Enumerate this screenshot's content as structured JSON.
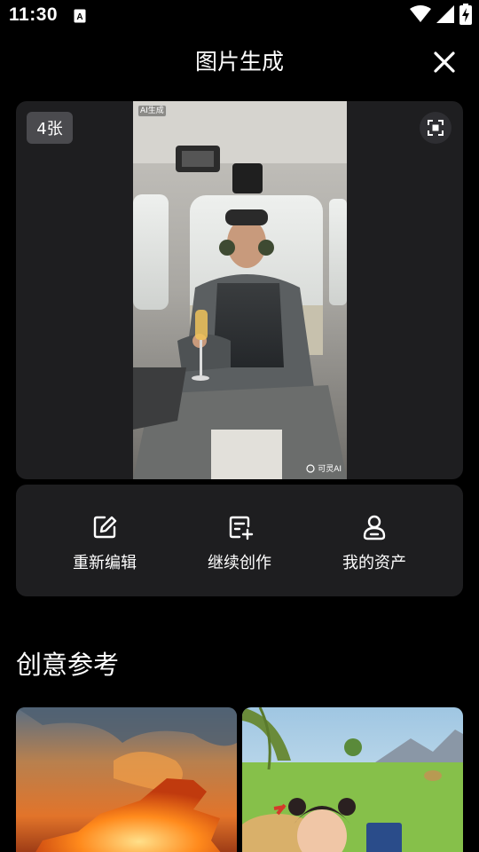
{
  "status_bar": {
    "time": "11:30",
    "notification_icon": "a-letter-icon",
    "icons": [
      "wifi-icon",
      "signal-icon",
      "battery-charging-icon"
    ]
  },
  "header": {
    "title": "图片生成",
    "close_icon": "close-icon"
  },
  "preview": {
    "count_badge": "4张",
    "ai_tag": "AI生成",
    "watermark": "可灵AI",
    "expand_icon": "expand-icon"
  },
  "actions": [
    {
      "label": "重新编辑",
      "icon": "edit-icon"
    },
    {
      "label": "继续创作",
      "icon": "continue-create-icon"
    },
    {
      "label": "我的资产",
      "icon": "user-assets-icon"
    }
  ],
  "section": {
    "title": "创意参考"
  },
  "colors": {
    "background": "#000000",
    "card": "#1e1e20",
    "badge": "#4a4a4e",
    "text": "#ffffff"
  }
}
